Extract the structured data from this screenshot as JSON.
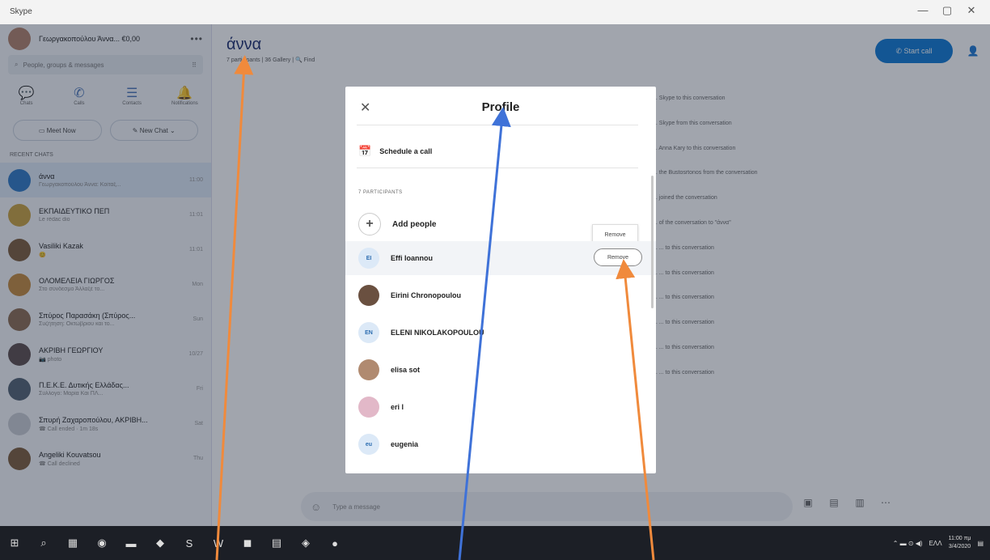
{
  "window": {
    "title": "Skype",
    "controls": [
      "—",
      "▢",
      "✕"
    ]
  },
  "sidebar": {
    "profile_name": "Γεωργακοπούλου Άννα... €0,00",
    "more": "•••",
    "search_placeholder": "People, groups & messages",
    "nav": [
      {
        "label": "Chats",
        "icon": "💬"
      },
      {
        "label": "Calls",
        "icon": "✆"
      },
      {
        "label": "Contacts",
        "icon": "☰"
      },
      {
        "label": "Notifications",
        "icon": "🔔"
      }
    ],
    "meet_now": "Meet Now",
    "new_chat": "New Chat",
    "recent_header": "RECENT CHATS",
    "chats": [
      {
        "name": "άννα",
        "preview": "Γεωργακοπούλου Άννα: Κοίταξ...",
        "time": "11:00",
        "avatar": "#2b78c5",
        "active": true
      },
      {
        "name": "ΕΚΠΑΙΔΕΥΤΙΚΟ ΠΕΠ",
        "preview": "Le rédac dio",
        "time": "11:01",
        "avatar": "#c9a03d",
        "active": false
      },
      {
        "name": "Vasiliki Kazak",
        "preview": "😊",
        "time": "11:01",
        "avatar": "#7a5a3a",
        "active": false
      },
      {
        "name": "ΟΛΟΜΕΛΕΙΑ ΓΙΩΡΓΟΣ",
        "preview": "Στο σύνδεσμο Άλλαξέ το...",
        "time": "Mon",
        "avatar": "#c3893c",
        "active": false
      },
      {
        "name": "Σπύρος Παρασάκη (Σπύρος...",
        "preview": "Συζήτηση: Οκτώβριου και το...",
        "time": "Sun",
        "avatar": "#8a6a50",
        "active": false
      },
      {
        "name": "ΑΚΡΙΒΗ ΓΕΩΡΓΙΟΥ",
        "preview": "📷 photo",
        "time": "10/27",
        "avatar": "#5a4a4a",
        "active": false
      },
      {
        "name": "Π.Ε.Κ.Ε. Δυτικής Ελλάδας...",
        "preview": "Σύλλογο: Μαρία Και ΠΛ...",
        "time": "Fri",
        "avatar": "#506070",
        "active": false
      },
      {
        "name": "Σπυρή Ζαχαροπούλου, ΑΚΡΙΒΗ...",
        "preview": "☎ Call ended · 1m 18s",
        "time": "Sat",
        "avatar": "#c9ccd2",
        "active": false
      },
      {
        "name": "Angeliki Kouvatsou",
        "preview": "☎ Call declined",
        "time": "Thu",
        "avatar": "#7a5a3a",
        "active": false
      }
    ]
  },
  "main": {
    "chat_title": "άννα",
    "chat_subtitle": "7 participants | 36 Gallery | 🔍 Find",
    "start_call": "Start call",
    "system_messages": [
      "... Skype to this conversation",
      "... Skype from this conversation",
      "... Anna Kary to this conversation",
      "... the Bustosrtonos from the conversation",
      "... joined the conversation",
      "... of the conversation to \"άννα\"",
      "... ... to this conversation",
      "... ... to this conversation",
      "... ... to this conversation",
      "... ... to this conversation",
      "... ... to this conversation",
      "... ... to this conversation"
    ],
    "composer_placeholder": "Type a message"
  },
  "profile_dialog": {
    "title": "Profile",
    "close_icon": "✕",
    "schedule_call": "Schedule a call",
    "participants_header": "7 PARTICIPANTS",
    "add_people": "Add people",
    "remove_tooltip": "Remove",
    "remove_button": "Remove",
    "participants": [
      {
        "name": "Effi Ioannou",
        "initials": "EI",
        "bg": "#dce9f7",
        "fg": "#2b6cb0",
        "hover": true
      },
      {
        "name": "Eirini Chronopoulou",
        "initials": "",
        "bg": "#6a5040",
        "fg": "#fff",
        "hover": false
      },
      {
        "name": "ELENI NIKOLAKOPOULOU",
        "initials": "EN",
        "bg": "#dce9f7",
        "fg": "#2b6cb0",
        "hover": false
      },
      {
        "name": "elisa sot",
        "initials": "",
        "bg": "#b08a70",
        "fg": "#fff",
        "hover": false
      },
      {
        "name": "eri l",
        "initials": "",
        "bg": "#e2b8c8",
        "fg": "#fff",
        "hover": false
      },
      {
        "name": "eugenia",
        "initials": "eu",
        "bg": "#dce9f7",
        "fg": "#2b6cb0",
        "hover": false
      }
    ]
  },
  "taskbar": {
    "icons": [
      "⊞",
      "⌕",
      "▦",
      "◉",
      "▬",
      "◆",
      "S",
      "W",
      "◼",
      "▤",
      "◈",
      "●"
    ],
    "clock_time": "11:00 πμ",
    "clock_date": "3/4/2020",
    "lang": "ΕΛΛ"
  },
  "colors": {
    "accent": "#0b78d4",
    "arrow_orange": "#f08a3c",
    "arrow_blue": "#3f72d8"
  }
}
